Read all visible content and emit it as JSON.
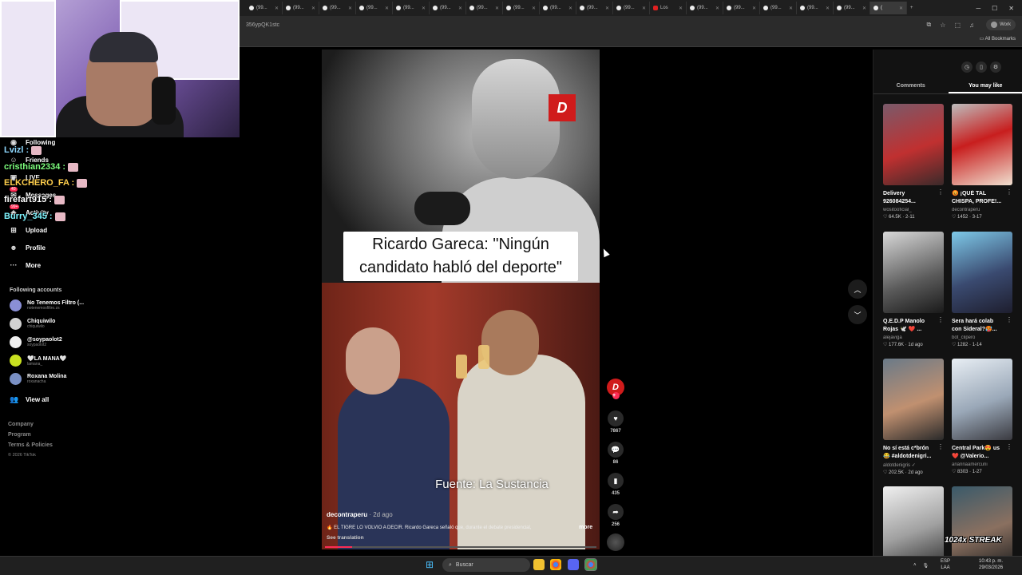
{
  "browser": {
    "tab_label": "(99...",
    "tab_label_yt": "Los",
    "active_tab_label": "(",
    "url": "356ypQK1stc",
    "profile": "Work",
    "all_bookmarks": "All Bookmarks"
  },
  "stream_chat": [
    {
      "user": "Lvizl",
      "color": "#8fd9ff"
    },
    {
      "user": "cristhian2334",
      "color": "#7dff7d"
    },
    {
      "user": "ELKCHERO_FA",
      "color": "#ffcf4d"
    },
    {
      "user": "firefart915",
      "color": "#ffffff"
    },
    {
      "user": "Burry_345",
      "color": "#7ff5ff"
    }
  ],
  "sidebar": {
    "items": [
      {
        "icon": "following-icon",
        "glyph": "◉",
        "label": "Following"
      },
      {
        "icon": "friends-icon",
        "glyph": "☺",
        "label": "Friends"
      },
      {
        "icon": "live-icon",
        "glyph": "▣",
        "label": "LIVE"
      },
      {
        "icon": "messages-icon",
        "glyph": "✉",
        "label": "Messages",
        "badge": "40"
      },
      {
        "icon": "activity-icon",
        "glyph": "◈",
        "label": "Activity",
        "badge": "99+"
      },
      {
        "icon": "upload-icon",
        "glyph": "⊞",
        "label": "Upload"
      },
      {
        "icon": "profile-icon",
        "glyph": "☻",
        "label": "Profile"
      },
      {
        "icon": "more-icon",
        "glyph": "···",
        "label": "More"
      }
    ],
    "following_title": "Following accounts",
    "accounts": [
      {
        "name": "No Tenemos Filtro (...",
        "handle": "notenemosfiltro.zs",
        "color": "#8a8fd6"
      },
      {
        "name": "Chiquiwilo",
        "handle": "chiquiwilo",
        "color": "#d2d2d2"
      },
      {
        "name": "@soypaolot2",
        "handle": "soypaolot2",
        "color": "#f0f0f0"
      },
      {
        "name": "🤍LA MANA🤍",
        "handle": "lamana_",
        "color": "#c8e020"
      },
      {
        "name": "Roxana Molina",
        "handle": "roxanacha",
        "color": "#7a90c4"
      }
    ],
    "view_all": "View all",
    "footer": [
      "Company",
      "Program",
      "Terms & Policies"
    ],
    "copyright": "© 2026 TikTok"
  },
  "video": {
    "logo": "D",
    "caption": "Ricardo Gareca: \"Ningún candidato habló del deporte\"",
    "source": "Fuente: La Sustancia",
    "username": "decontraperu",
    "posted": " · 2d ago",
    "description": "🔥 EL TIGRE LO VOLVIÓ A DECIR. Ricardo Gareca señaló que, durante el debate presidencial,",
    "more": "more",
    "see_translation": "See translation",
    "progress": 0.1
  },
  "actions": {
    "avatar": "D",
    "likes": "7867",
    "comments": "86",
    "saves": "435",
    "shares": "256"
  },
  "panel": {
    "tabs": [
      "Comments",
      "You may like"
    ],
    "active_tab": 1,
    "cards": [
      {
        "title": "Delivery",
        "title2": "926084254...",
        "user": "wositooficial_",
        "stats": "♡ 64.5K · 2-11",
        "bg": "linear-gradient(160deg,#7a5a6a,#c03030 55%,#3a2a2a)"
      },
      {
        "title": "😡 ¡QUÉ TAL",
        "title2": "CHISPA, PROFE!...",
        "user": "decontraperu",
        "stats": "♡ 1452 · 3-17",
        "bg": "linear-gradient(160deg,#bdbdbd,#c81e1e 45%,#f0e0d0)"
      },
      {
        "title": "Q.E.D.P Manolo",
        "title2": "Rojas 🕊️ ❤️ ...",
        "user": "alejaviga",
        "stats": "♡ 177.6K · 1d ago",
        "bg": "linear-gradient(160deg,#d8d8d8,#5a5a5a 60%,#1a1a1a)"
      },
      {
        "title": "Sera hará colab",
        "title2": "con Sideral?🥵...",
        "user": "bot_clipero",
        "stats": "♡ 1282 · 1-14",
        "bg": "linear-gradient(160deg,#7ec9e8,#3a4a70 55%,#1e1e2e)"
      },
      {
        "title": "No sí está c*brón",
        "title2": "😂 #aldotdenigri...",
        "user": "aldotdenigris ✓",
        "stats": "♡ 202.5K · 2d ago",
        "bg": "linear-gradient(160deg,#6a7a88,#c09070 55%,#2a2a2a)"
      },
      {
        "title": "Central Park😍 us",
        "title2": "❤️ @Valerio...",
        "user": "ariannaamercurii",
        "stats": "♡ 8303 · 1-27",
        "bg": "linear-gradient(160deg,#e8eef4,#9aa8b8 55%,#3a3a40)"
      },
      {
        "title": "",
        "title2": "",
        "user": "",
        "stats": "",
        "bg": "linear-gradient(160deg,#f0f0f0,#a0a0a0 55%,#303030)"
      },
      {
        "title": "",
        "title2": "",
        "user": "",
        "stats": "",
        "bg": "linear-gradient(160deg,#3a5a6a,#8a7060 55%,#202020)"
      }
    ],
    "streak": "1024x STREAK"
  },
  "taskbar": {
    "search": "Buscar",
    "lang": "ESP",
    "lang2": "LAA",
    "time": "10:43 p. m.",
    "date": "29/03/2026"
  }
}
